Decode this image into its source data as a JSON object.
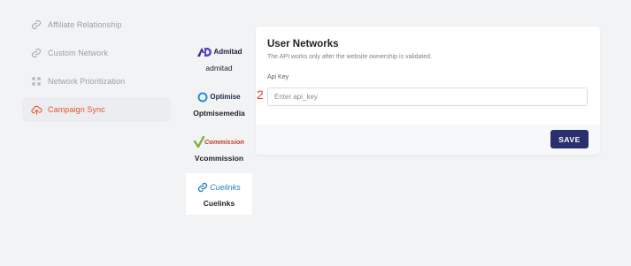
{
  "sidebar": {
    "items": [
      {
        "label": "Affiliate Relationship",
        "icon": "link-icon",
        "active": false
      },
      {
        "label": "Custom Network",
        "icon": "link-icon",
        "active": false
      },
      {
        "label": "Network Prioritization",
        "icon": "expand-icon",
        "active": false
      },
      {
        "label": "Campaign Sync",
        "icon": "cloud-upload-icon",
        "active": true
      }
    ]
  },
  "networks": [
    {
      "logo_text": "Admitad",
      "name": "admitad",
      "selected": false
    },
    {
      "logo_text": "Optimise",
      "name": "Optmisemedia",
      "selected": false
    },
    {
      "logo_text": "Commission",
      "name": "Vcommission",
      "selected": false
    },
    {
      "logo_text": "Cuelinks",
      "name": "Cuelinks",
      "selected": true
    }
  ],
  "card": {
    "title": "User Networks",
    "subtitle": "The API works only after the website ownership is validated.",
    "field_label": "Api Key",
    "field_marker": "2",
    "api_placeholder": "Enter api_key",
    "save_label": "SAVE"
  },
  "colors": {
    "accent": "#e8532f",
    "primary_button": "#2a2f6e",
    "background": "#f2f3f5"
  }
}
